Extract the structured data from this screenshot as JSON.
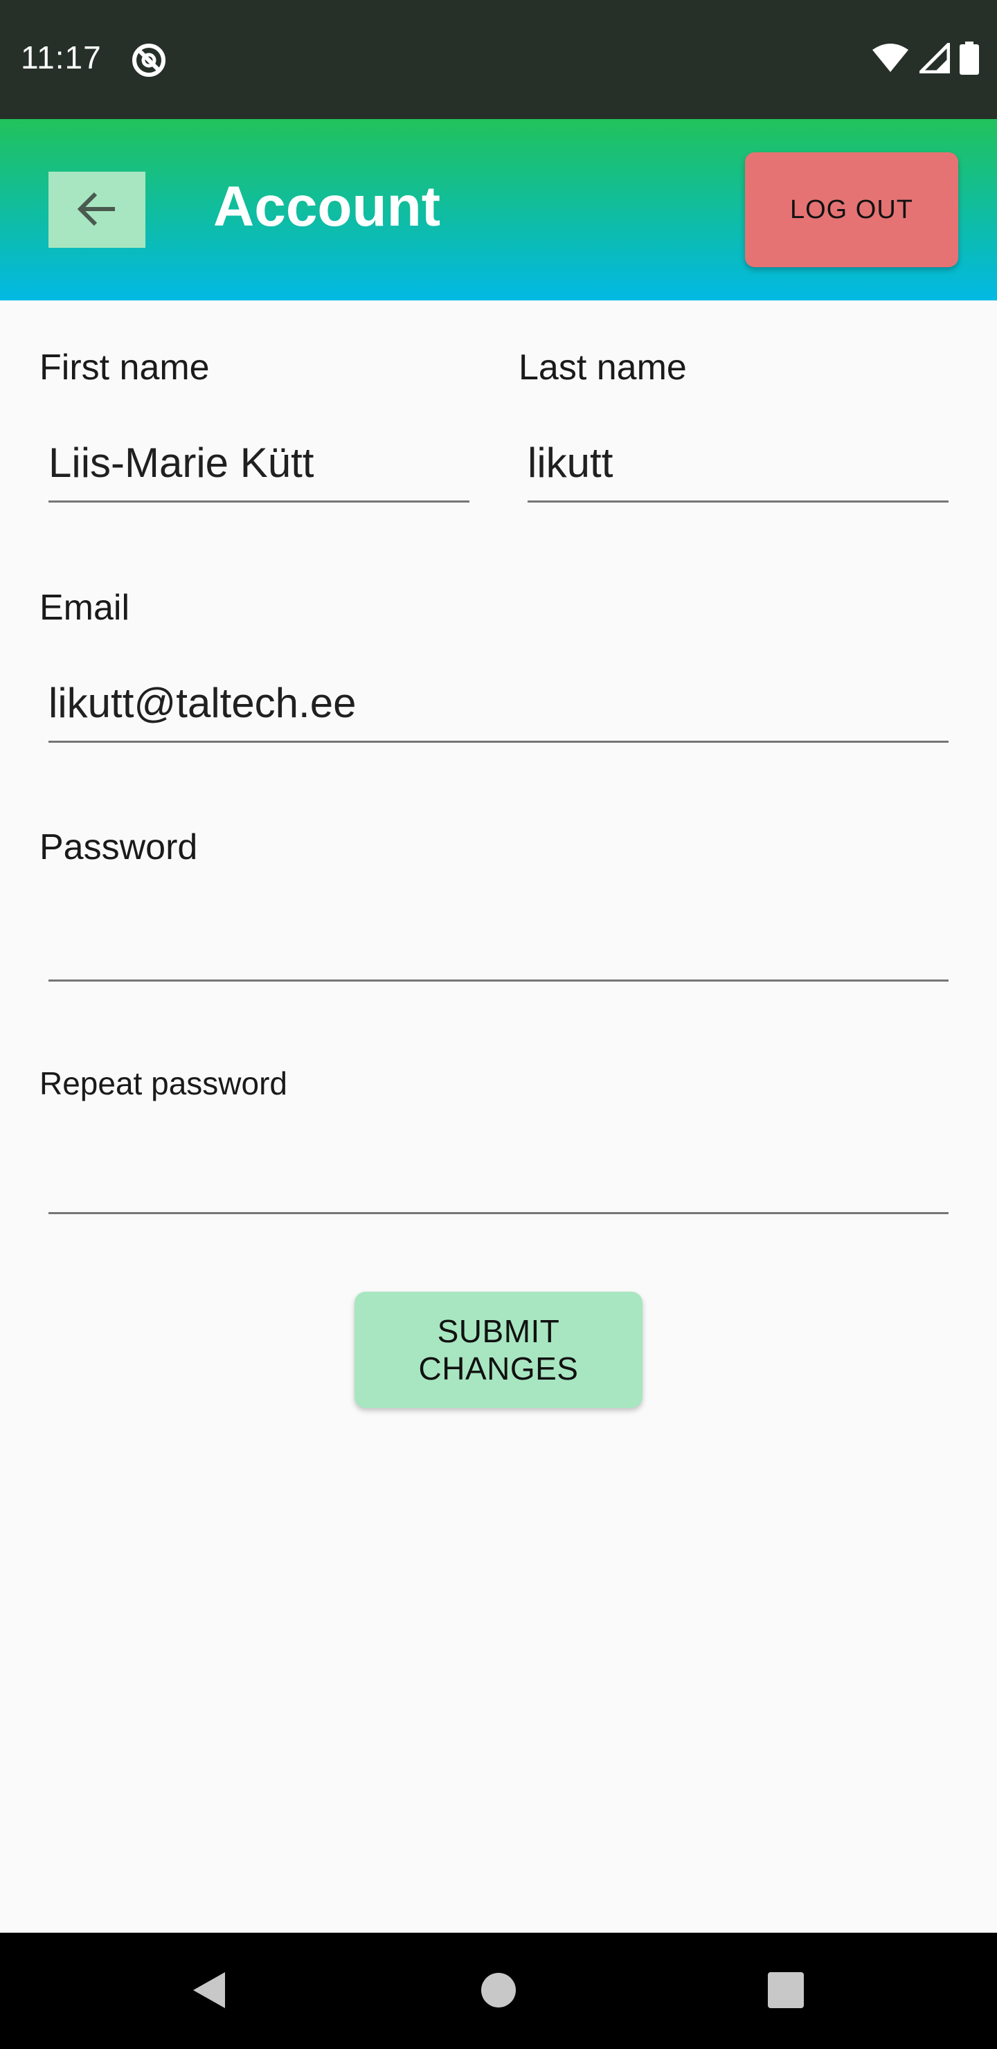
{
  "status_bar": {
    "time": "11:17"
  },
  "app_bar": {
    "title": "Account",
    "logout_label": "LOG OUT",
    "colors": {
      "gradient_top": "#22c25c",
      "gradient_bottom": "#02b9e4",
      "back_button": "#a8e6c1",
      "logout_button": "#e57373"
    }
  },
  "form": {
    "first_name": {
      "label": "First name",
      "value": "Liis-Marie Kütt"
    },
    "last_name": {
      "label": "Last name",
      "value": "likutt"
    },
    "email": {
      "label": "Email",
      "value": "likutt@taltech.ee"
    },
    "password": {
      "label": "Password",
      "value": ""
    },
    "repeat_password": {
      "label": "Repeat password",
      "value": ""
    },
    "submit_label": "SUBMIT CHANGES"
  },
  "icons": {
    "back": "arrow-left-icon",
    "status_app": "at-sign-icon",
    "wifi": "wifi-icon",
    "signal": "cell-signal-icon",
    "battery": "battery-icon",
    "nav_back": "nav-back-icon",
    "nav_home": "nav-home-icon",
    "nav_recents": "nav-recents-icon"
  }
}
